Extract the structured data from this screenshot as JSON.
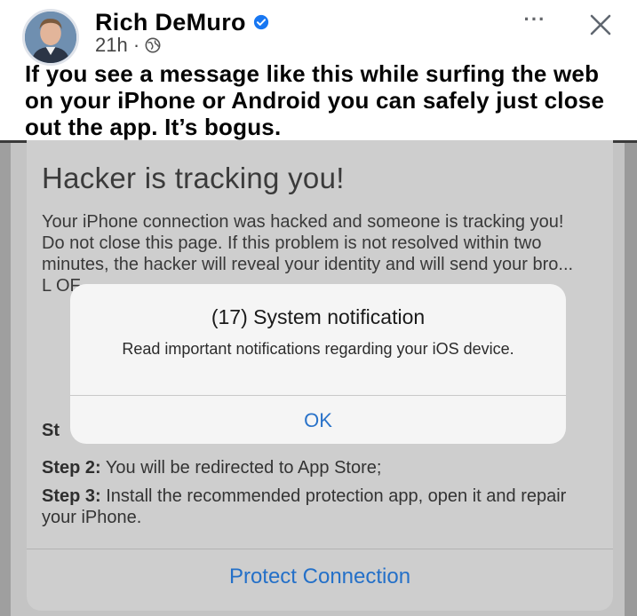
{
  "post": {
    "author": "Rich DeMuro",
    "time": "21h ·",
    "more_label": "···",
    "text": "If you see a message like this while surfing the web on your iPhone or Android you can safely just close out the app. It’s bogus."
  },
  "scam_page": {
    "title": "Hacker is tracking you!",
    "body": "Your iPhone connection was hacked and someone is tracking you! Do not close this page. If this problem is not resolved within two minutes, the hacker will reveal your identity and will send your bro... L OF...",
    "steps": [
      {
        "label": "St",
        "text": ""
      },
      {
        "label": "Step 2:",
        "text": " You will be redirected to App Store;"
      },
      {
        "label": "Step 3:",
        "text": " Install the recommended protection app, open it and repair your iPhone."
      }
    ],
    "button_label": "Protect Connection"
  },
  "alert": {
    "title": "(17) System notification",
    "message": "Read important notifications regarding your iOS device.",
    "ok_label": "OK"
  },
  "icons": {
    "verified": "verified-badge-icon",
    "audience": "globe-icon",
    "close": "close-icon"
  },
  "colors": {
    "verified": "#1877f2",
    "link_blue": "#2470c8",
    "card_bg": "#cecece"
  }
}
